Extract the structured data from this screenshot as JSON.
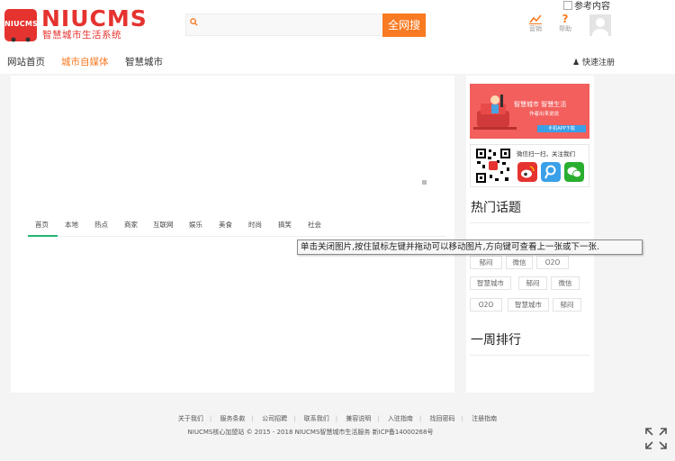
{
  "header": {
    "logo_badge_text": "NIUCMS",
    "logo_name": "NIUCMS",
    "logo_slogan": "智慧城市生活系统",
    "search": {
      "placeholder": "",
      "button_label": "全网搜"
    },
    "icons": [
      {
        "name": "chart-icon",
        "label": "营销",
        "color": "#f87a22"
      },
      {
        "name": "help-icon",
        "label": "帮助",
        "color": "#f87a22"
      }
    ],
    "ref_content_label": "参考内容"
  },
  "nav": {
    "items": [
      {
        "label": "网站首页",
        "active": false
      },
      {
        "label": "城市自媒体",
        "active": true
      },
      {
        "label": "智慧城市",
        "active": false
      }
    ],
    "register_label": "快速注册"
  },
  "tabs": [
    "首页",
    "本地",
    "热点",
    "商家",
    "互联网",
    "娱乐",
    "美食",
    "时尚",
    "搞笑",
    "社会"
  ],
  "tooltip": "单击关闭图片,按住鼠标左键并拖动可以移动图片,方向键可查看上一张或下一张.",
  "sidebar": {
    "promo": {
      "title": "智慧城市  智慧生活",
      "subtitle": "作者出来说说",
      "button": "手机APP下载"
    },
    "follow_text": "微信扫一扫，关注我们",
    "hot_topics_title": "热门话题",
    "hot_tags": [
      [
        "郁闷",
        "微信",
        "O2O"
      ],
      [
        "智慧城市",
        "郁闷",
        "微信"
      ],
      [
        "O2O",
        "智慧城市",
        "郁闷"
      ]
    ],
    "weekly_rank_title": "一周排行"
  },
  "footer": {
    "links": [
      "关于我们",
      "服务条款",
      "公司招聘",
      "联系我们",
      "兼容说明",
      "入驻指南",
      "找回密码",
      "注册指南"
    ],
    "copyright": "NIUCMS核心加盟站  © 2015 - 2018  NIUCMS智慧城市生活服务  新ICP备14000268号"
  },
  "colors": {
    "brand": "#e5332f",
    "accent": "#f87a22",
    "tab_indicator": "#22b573",
    "link": "#3aa0e8"
  }
}
